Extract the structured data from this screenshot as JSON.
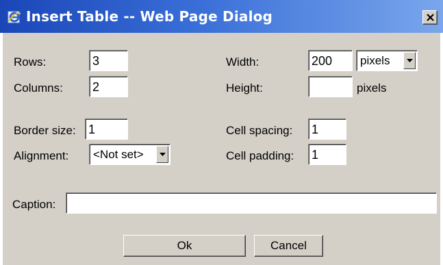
{
  "window": {
    "title": "Insert Table -- Web Page Dialog",
    "icon": "ie-icon",
    "close_glyph": "✕"
  },
  "rows": {
    "label": "Rows:",
    "value": "3"
  },
  "columns": {
    "label": "Columns:",
    "value": "2"
  },
  "width": {
    "label": "Width:",
    "value": "200",
    "unit": "pixels"
  },
  "height": {
    "label": "Height:",
    "value": "",
    "unit": "pixels"
  },
  "border_size": {
    "label": "Border size:",
    "value": "1"
  },
  "alignment": {
    "label": "Alignment:",
    "value": "<Not set>"
  },
  "cell_spacing": {
    "label": "Cell spacing:",
    "value": "1"
  },
  "cell_padding": {
    "label": "Cell padding:",
    "value": "1"
  },
  "caption": {
    "label": "Caption:",
    "value": ""
  },
  "buttons": {
    "ok": "Ok",
    "cancel": "Cancel"
  },
  "colors": {
    "titlebar_start": "#1a46b8",
    "titlebar_end": "#7aa6ec",
    "dialog_bg": "#d4d0c8"
  }
}
